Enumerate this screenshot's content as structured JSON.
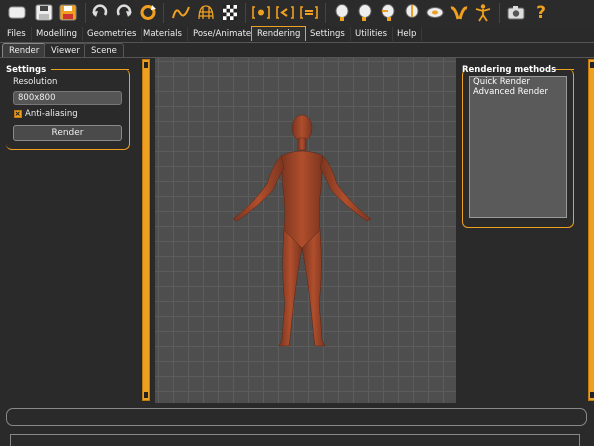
{
  "toolbar": {
    "icons": [
      "new-file-icon",
      "save-icon",
      "export-icon",
      "undo-icon",
      "redo-icon",
      "reset-icon",
      "smooth-icon",
      "wireframe-icon",
      "background-icon",
      "front-view-icon",
      "back-view-icon",
      "side-view-icon",
      "head-front-icon",
      "head-left-icon",
      "head-right-icon",
      "head-back-icon",
      "face-icon",
      "hands-icon",
      "full-body-icon",
      "screenshot-icon",
      "help-icon"
    ],
    "help_glyph": "?"
  },
  "menu": {
    "tabs": [
      "Files",
      "Modelling",
      "Geometries",
      "Materials",
      "Pose/Animate",
      "Rendering",
      "Settings",
      "Utilities",
      "Help"
    ],
    "active": "Rendering"
  },
  "subtabs": {
    "items": [
      "Render",
      "Viewer",
      "Scene"
    ],
    "active": "Render"
  },
  "settings": {
    "title": "Settings",
    "resolution_label": "Resolution",
    "resolution_value": "800x800",
    "antialias_label": "Anti-aliasing",
    "antialias_checked": true,
    "render_button": "Render"
  },
  "rendering_methods": {
    "title": "Rendering methods",
    "items": [
      "Quick Render",
      "Advanced Render"
    ]
  },
  "status": {
    "text": ""
  },
  "colors": {
    "accent": "#f0a020",
    "skin": "#a44a2a"
  }
}
